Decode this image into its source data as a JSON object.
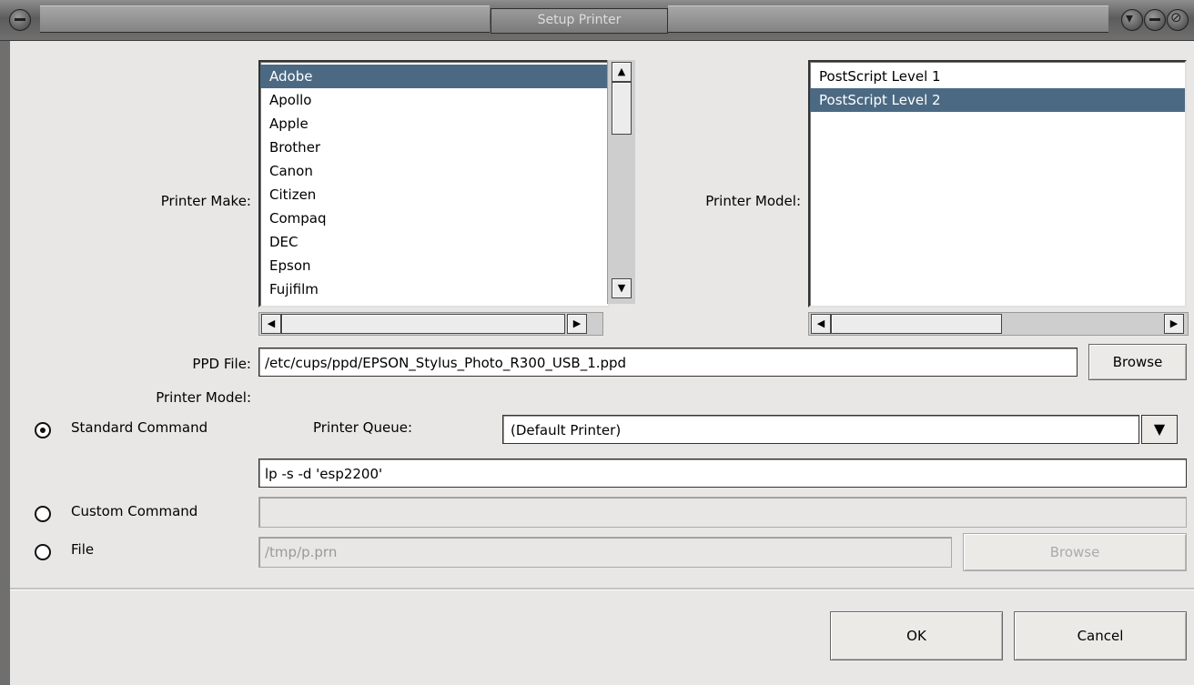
{
  "window": {
    "title": "Setup Printer"
  },
  "labels": {
    "printer_make": "Printer Make:",
    "printer_model": "Printer Model:",
    "ppd_file": "PPD File:",
    "printer_model_2": "Printer Model:",
    "printer_queue": "Printer Queue:"
  },
  "make_list": [
    "Adobe",
    "Apollo",
    "Apple",
    "Brother",
    "Canon",
    "Citizen",
    "Compaq",
    "DEC",
    "Epson",
    "Fujifilm"
  ],
  "make_selected_index": 0,
  "model_list": [
    "PostScript Level 1",
    "PostScript Level 2"
  ],
  "model_selected_index": 1,
  "ppd_file": {
    "value": "/etc/cups/ppd/EPSON_Stylus_Photo_R300_USB_1.ppd",
    "browse_label": "Browse"
  },
  "options": {
    "standard_label": "Standard Command",
    "custom_label": "Custom Command",
    "file_label": "File",
    "selected": "standard"
  },
  "printer_queue": {
    "value": "(Default Printer)"
  },
  "standard_command": {
    "value": "lp -s -d 'esp2200'"
  },
  "custom_command": {
    "value": ""
  },
  "file": {
    "value": "/tmp/p.prn",
    "browse_label": "Browse"
  },
  "buttons": {
    "ok": "OK",
    "cancel": "Cancel"
  },
  "colors": {
    "selection": "#4b6983",
    "background": "#e8e7e5"
  }
}
